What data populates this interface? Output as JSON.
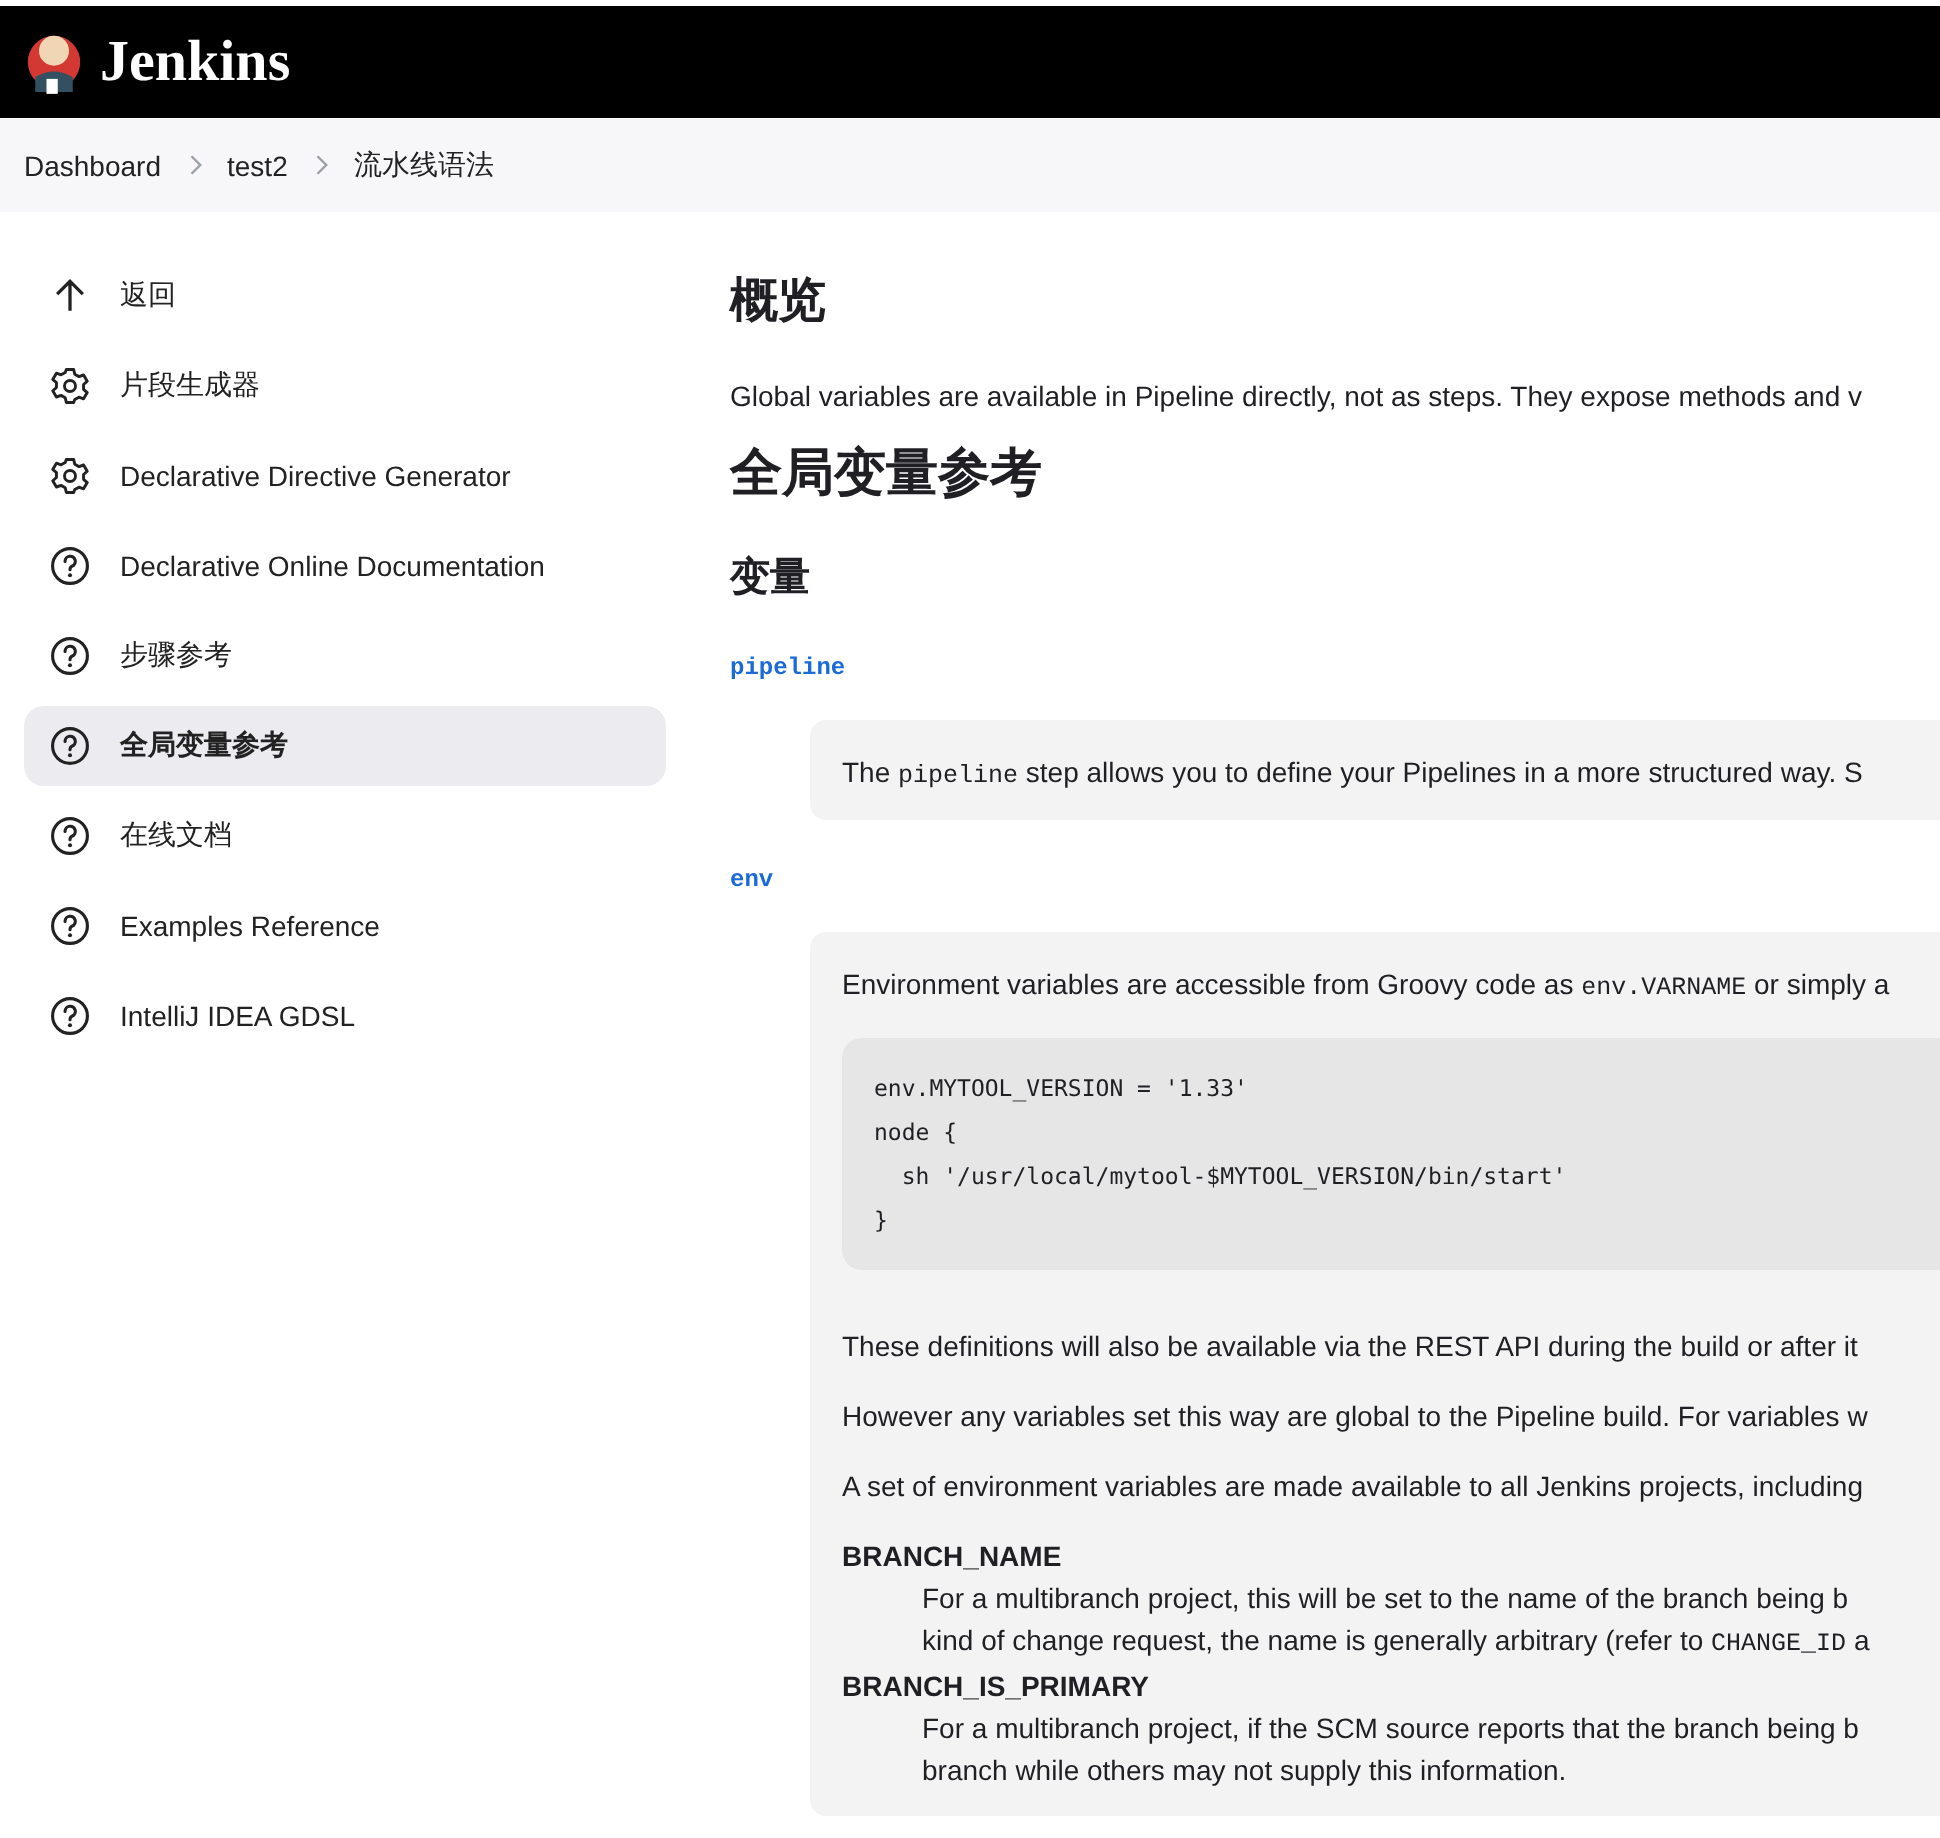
{
  "header": {
    "title": "Jenkins"
  },
  "breadcrumb": [
    {
      "label": "Dashboard"
    },
    {
      "label": "test2"
    },
    {
      "label": "流水线语法"
    }
  ],
  "sidebar": {
    "items": [
      {
        "label": "返回",
        "kind": "back",
        "selected": false
      },
      {
        "label": "片段生成器",
        "kind": "tool",
        "selected": false
      },
      {
        "label": "Declarative Directive Generator",
        "kind": "tool",
        "selected": false
      },
      {
        "label": "Declarative Online Documentation",
        "kind": "help",
        "selected": false
      },
      {
        "label": "步骤参考",
        "kind": "help",
        "selected": false
      },
      {
        "label": "全局变量参考",
        "kind": "help",
        "selected": true
      },
      {
        "label": "在线文档",
        "kind": "help",
        "selected": false
      },
      {
        "label": "Examples Reference",
        "kind": "help",
        "selected": false
      },
      {
        "label": "IntelliJ IDEA GDSL",
        "kind": "help",
        "selected": false
      }
    ]
  },
  "content": {
    "overview_heading": "概览",
    "intro": "Global variables are available in Pipeline directly, not as steps. They expose methods and v",
    "page_heading": "全局变量参考",
    "section_heading": "变量",
    "variables": [
      {
        "name": "pipeline",
        "blocks": [
          {
            "kind": "paragraph",
            "segments": [
              {
                "kind": "text",
                "text": "The "
              },
              {
                "kind": "code",
                "text": "pipeline"
              },
              {
                "kind": "text",
                "text": " step allows you to define your Pipelines in a more structured way. S"
              }
            ]
          }
        ]
      },
      {
        "name": "env",
        "blocks": [
          {
            "kind": "paragraph",
            "segments": [
              {
                "kind": "text",
                "text": "Environment variables are accessible from Groovy code as "
              },
              {
                "kind": "code",
                "text": "env.VARNAME"
              },
              {
                "kind": "text",
                "text": " or simply a"
              }
            ]
          },
          {
            "kind": "code_block",
            "lines": [
              "env.MYTOOL_VERSION = '1.33'",
              "node {",
              "  sh '/usr/local/mytool-$MYTOOL_VERSION/bin/start'",
              "}"
            ]
          },
          {
            "kind": "paragraph",
            "segments": [
              {
                "kind": "text",
                "text": "These definitions will also be available via the REST API during the build or after it"
              }
            ]
          },
          {
            "kind": "paragraph",
            "segments": [
              {
                "kind": "text",
                "text": "However any variables set this way are global to the Pipeline build. For variables w"
              }
            ]
          },
          {
            "kind": "paragraph",
            "segments": [
              {
                "kind": "text",
                "text": "A set of environment variables are made available to all Jenkins projects, including"
              }
            ]
          },
          {
            "kind": "definitions",
            "items": [
              {
                "term": "BRANCH_NAME",
                "lines": [
                  [
                    {
                      "kind": "text",
                      "text": "For a multibranch project, this will be set to the name of the branch being b"
                    }
                  ],
                  [
                    {
                      "kind": "text",
                      "text": "kind of change request, the name is generally arbitrary (refer to "
                    },
                    {
                      "kind": "code",
                      "text": "CHANGE_ID"
                    },
                    {
                      "kind": "text",
                      "text": " a"
                    }
                  ]
                ]
              },
              {
                "term": "BRANCH_IS_PRIMARY",
                "lines": [
                  [
                    {
                      "kind": "text",
                      "text": "For a multibranch project, if the SCM source reports that the branch being b"
                    }
                  ],
                  [
                    {
                      "kind": "text",
                      "text": "branch while others may not supply this information."
                    }
                  ]
                ]
              }
            ]
          }
        ]
      }
    ]
  }
}
